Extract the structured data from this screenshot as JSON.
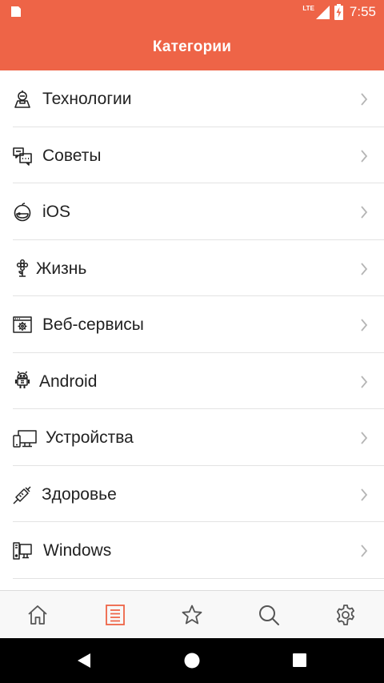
{
  "status_bar": {
    "network": "LTE",
    "time": "7:55"
  },
  "app_bar": {
    "title": "Категории"
  },
  "categories": [
    {
      "label": "Технологии",
      "icon": "technology-icon"
    },
    {
      "label": "Советы",
      "icon": "chat-tips-icon"
    },
    {
      "label": "iOS",
      "icon": "apple-icon"
    },
    {
      "label": "Жизнь",
      "icon": "flower-icon"
    },
    {
      "label": "Веб-сервисы",
      "icon": "web-services-icon"
    },
    {
      "label": "Android",
      "icon": "android-robot-icon"
    },
    {
      "label": "Устройства",
      "icon": "devices-icon"
    },
    {
      "label": "Здоровье",
      "icon": "syringe-icon"
    },
    {
      "label": "Windows",
      "icon": "windows-pc-icon"
    }
  ],
  "bottom_nav": {
    "items": [
      {
        "name": "home",
        "icon": "home-icon",
        "active": false
      },
      {
        "name": "categories",
        "icon": "list-icon",
        "active": true
      },
      {
        "name": "favorites",
        "icon": "star-icon",
        "active": false
      },
      {
        "name": "search",
        "icon": "search-icon",
        "active": false
      },
      {
        "name": "settings",
        "icon": "gear-icon",
        "active": false
      }
    ],
    "active_color": "#ee6447",
    "inactive_color": "#555555"
  },
  "colors": {
    "accent": "#ee6447",
    "text": "#222222",
    "divider": "#e3e3e3"
  }
}
